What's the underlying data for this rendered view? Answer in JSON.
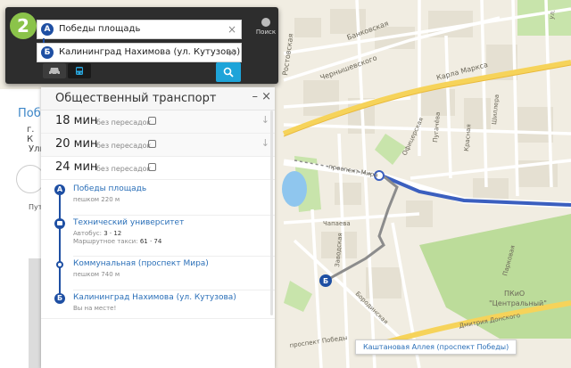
{
  "search": {
    "logo": "2",
    "from": "Победы площадь",
    "to": "Калининград Нахимова (ул. Кутузова)",
    "from_pin": "А",
    "to_pin": "Б",
    "search_label": "Поиск"
  },
  "background_card": {
    "title": "Побе",
    "sub": "г. К",
    "sub2": "Ули",
    "paths": "Путь"
  },
  "transit": {
    "title": "Общественный транспорт",
    "minimize": "–",
    "close": "×",
    "options": [
      {
        "time": "18 мин",
        "note": "без пересадок"
      },
      {
        "time": "20 мин",
        "note": "без пересадок"
      },
      {
        "time": "24 мин",
        "note": "без пересадок"
      }
    ],
    "steps": [
      {
        "marker": "А",
        "name": "Победы площадь",
        "meta": "пешком 220 м"
      },
      {
        "name": "Технический университет",
        "bus_label": "Автобус:",
        "bus_values": "3 · 12",
        "taxi_label": "Маршрутное такси:",
        "taxi_values": "61 · 74"
      },
      {
        "name": "Коммунальная (проспект Мира)",
        "meta": "пешком 740 м"
      },
      {
        "marker": "Б",
        "name": "Калининград Нахимова (ул. Кутузова)",
        "meta": "Вы на месте!"
      }
    ]
  },
  "map": {
    "labels": {
      "rostovskaya": "Ростовская",
      "bankovskaya": "Банковская",
      "chernyshevskogo": "Чернышевского",
      "karla_marksa": "Карла Маркса",
      "ofitserskaya": "Офицерская",
      "pugacheva": "Пугачёва",
      "krasnaya": "Красная",
      "shiller": "Шиллера",
      "prospekt_mira": "проспект Мира",
      "chapaeva": "Чапаева",
      "zavokzalnaya": "Заводская",
      "borodinskaya": "Бородинская",
      "dmitriya_donskogo": "Дмитрия Донского",
      "prospekt_pobedy": "проспект Победы",
      "parkovaya": "Парковая",
      "pkio": "ПКиО",
      "tsentralny": "\"Центральный\"",
      "ulitsa_top": "ул."
    },
    "tooltip": "Каштановая Аллея (проспект Победы)",
    "pin_b": "Б"
  },
  "colors": {
    "route_blue": "#3b5fbf",
    "walk_gray": "#8c8c8c",
    "park_green": "#bcdc9a",
    "road_yellow": "#f6d35a",
    "water": "#8fc6ee"
  }
}
